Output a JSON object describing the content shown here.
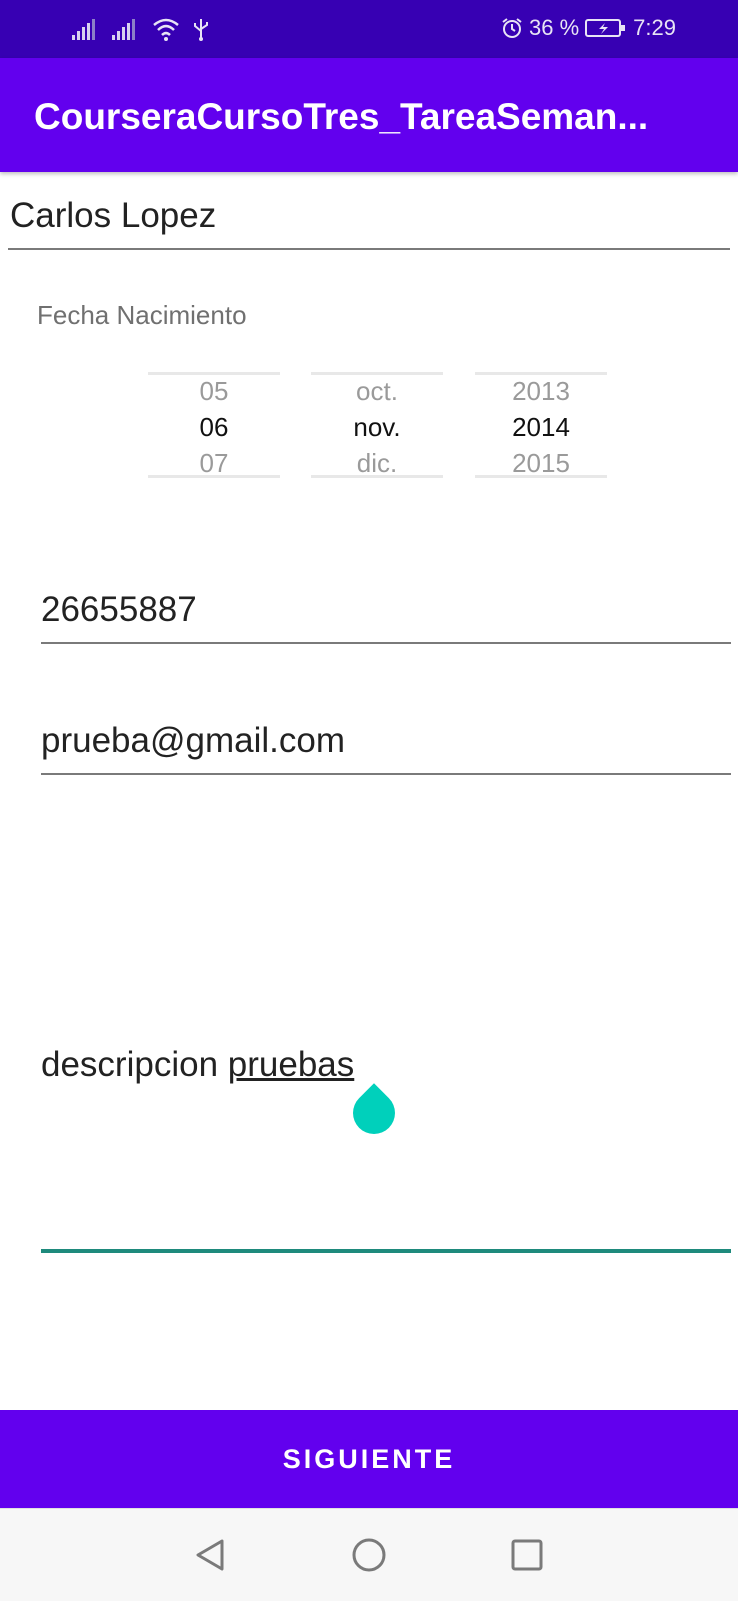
{
  "status_bar": {
    "battery_percent": "36 %",
    "time": "7:29",
    "icons": [
      "signal-icon",
      "signal-icon",
      "wifi-icon",
      "usb-icon",
      "alarm-icon",
      "battery-charging-icon"
    ]
  },
  "app_bar": {
    "title": "CourseraCursoTres_TareaSeman..."
  },
  "form": {
    "name_value": "Carlos Lopez",
    "birth_label": "Fecha Nacimiento",
    "date_picker": {
      "day": {
        "prev": "05",
        "current": "06",
        "next": "07"
      },
      "month": {
        "prev": "oct.",
        "current": "nov.",
        "next": "dic."
      },
      "year": {
        "prev": "2013",
        "current": "2014",
        "next": "2015"
      }
    },
    "phone_value": "26655887",
    "email_value": "prueba@gmail.com",
    "description_word1": "descripcion",
    "description_word2": "pruebas"
  },
  "actions": {
    "next_label": "SIGUIENTE"
  },
  "nav_bar": {
    "icons": [
      "back-icon",
      "home-icon",
      "recents-icon"
    ]
  },
  "colors": {
    "status_bar": "#3700b3",
    "primary": "#6200ee",
    "accent": "#00d0bb"
  }
}
